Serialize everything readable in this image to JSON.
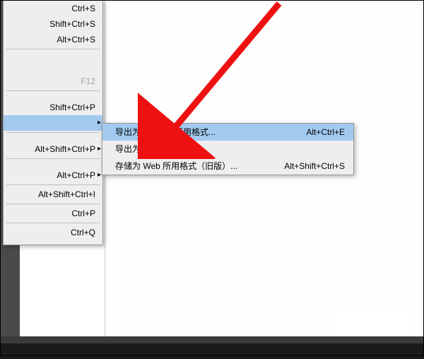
{
  "main_menu": {
    "items": [
      {
        "shortcut": "Ctrl+S",
        "has_submenu": false,
        "highlight": false,
        "dim": false
      },
      {
        "shortcut": "Shift+Ctrl+S",
        "has_submenu": false,
        "highlight": false,
        "dim": false
      },
      {
        "shortcut": "Alt+Ctrl+S",
        "has_submenu": false,
        "highlight": false,
        "dim": false
      },
      {
        "sep": true
      },
      {
        "shortcut": "F12",
        "has_submenu": false,
        "highlight": false,
        "dim": true
      },
      {
        "sep": true
      },
      {
        "shortcut": "Shift+Ctrl+P",
        "has_submenu": false,
        "highlight": false,
        "dim": false
      },
      {
        "shortcut": "",
        "has_submenu": true,
        "highlight": true,
        "dim": false
      },
      {
        "sep": true
      },
      {
        "shortcut": "Alt+Shift+Ctrl+P",
        "has_submenu": true,
        "highlight": false,
        "dim": false
      },
      {
        "sep": true
      },
      {
        "shortcut": "Alt+Ctrl+P",
        "has_submenu": true,
        "highlight": false,
        "dim": false
      },
      {
        "sep": true
      },
      {
        "shortcut": "Alt+Shift+Ctrl+I",
        "has_submenu": false,
        "highlight": false,
        "dim": false
      },
      {
        "sep": true
      },
      {
        "shortcut": "Ctrl+P",
        "has_submenu": false,
        "highlight": false,
        "dim": false
      },
      {
        "sep": true
      },
      {
        "shortcut": "Ctrl+Q",
        "has_submenu": false,
        "highlight": false,
        "dim": false
      }
    ]
  },
  "submenu": {
    "items": [
      {
        "label": "导出为多种屏幕所用格式...",
        "shortcut": "Alt+Ctrl+E",
        "highlight": true
      },
      {
        "label": "导出为...",
        "shortcut": "",
        "highlight": false
      },
      {
        "label": "存储为 Web 所用格式（旧版）...",
        "shortcut": "Alt+Shift+Ctrl+S",
        "highlight": false
      }
    ]
  },
  "arrow_glyph": "▸",
  "annotation": "red-arrow"
}
